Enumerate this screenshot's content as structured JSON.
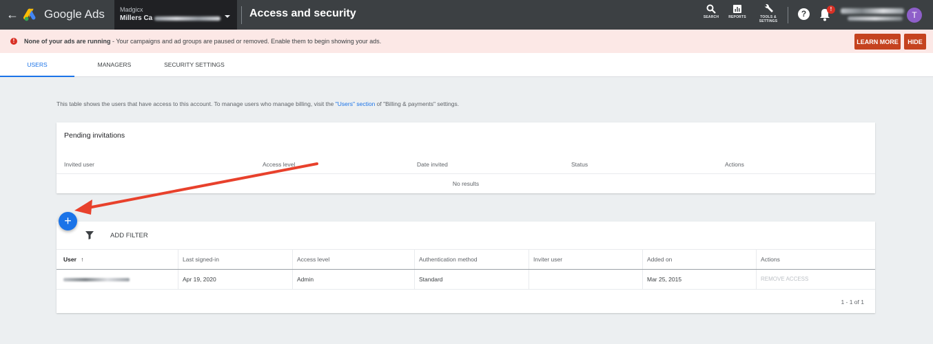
{
  "topbar": {
    "product_name": "Google Ads",
    "account": {
      "name": "Madgicx",
      "id": "Millers Ca"
    },
    "page_title": "Access and security",
    "tools": [
      {
        "label": "SEARCH",
        "icon": "search-icon"
      },
      {
        "label": "REPORTS",
        "icon": "reports-icon"
      },
      {
        "label": "TOOLS &",
        "label2": "SETTINGS",
        "icon": "wrench-icon"
      }
    ],
    "help": "?",
    "bell_badge": "!",
    "avatar_initial": "T"
  },
  "alert": {
    "bold_text": "None of your ads are running",
    "text": " - Your campaigns and ad groups are paused or removed. Enable them to begin showing your ads.",
    "learn_more": "LEARN MORE",
    "hide": "HIDE",
    "color": "#c5431f"
  },
  "tabs": [
    {
      "label": "USERS",
      "active": true
    },
    {
      "label": "MANAGERS",
      "active": false
    },
    {
      "label": "SECURITY SETTINGS",
      "active": false
    }
  ],
  "intro": {
    "before": "This table shows the users that have access to this account. To manage users who manage billing, visit the ",
    "link": "\"Users\" section",
    "after": " of \"Billing & payments\" settings."
  },
  "pending": {
    "title": "Pending invitations",
    "columns": [
      "Invited user",
      "Access level",
      "Date invited",
      "Status",
      "Actions"
    ],
    "empty": "No results"
  },
  "users": {
    "add_filter": "ADD FILTER",
    "columns": [
      "User",
      "Last signed-in",
      "Access level",
      "Authentication method",
      "Inviter user",
      "Added on",
      "Actions"
    ],
    "sort_indicator": "↑",
    "rows": [
      {
        "user": "",
        "last_signed_in": "Apr 19, 2020",
        "access_level": "Admin",
        "auth_method": "Standard",
        "inviter": "",
        "added_on": "Mar 25, 2015",
        "action": "REMOVE ACCESS"
      }
    ],
    "pagination": "1 - 1 of 1"
  },
  "fab": "+",
  "accent_color": "#1a73e8"
}
